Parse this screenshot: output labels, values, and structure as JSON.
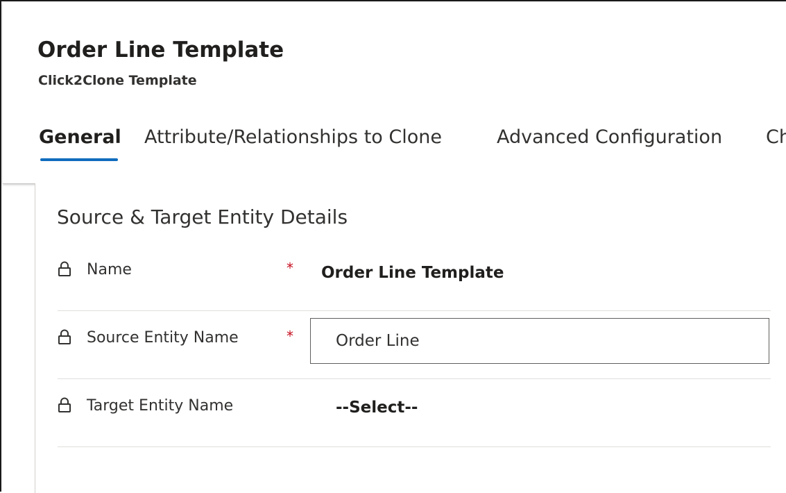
{
  "record": {
    "title": "Order Line Template",
    "subtitle": "Click2Clone Template"
  },
  "tabs": [
    {
      "label": "General",
      "active": true
    },
    {
      "label": "Attribute/Relationships to Clone",
      "active": false
    },
    {
      "label": "Advanced Configuration",
      "active": false
    },
    {
      "label": "Ch",
      "active": false
    }
  ],
  "section": {
    "title": "Source & Target Entity Details",
    "fields": [
      {
        "label": "Name",
        "required": true,
        "required_mark": "*",
        "value": "Order Line Template",
        "locked": true
      },
      {
        "label": "Source Entity Name",
        "required": true,
        "required_mark": "*",
        "value": "Order Line",
        "locked": true
      },
      {
        "label": "Target Entity Name",
        "required": false,
        "value": "--Select--",
        "locked": true
      }
    ]
  },
  "icons": {
    "lock": "lock-icon"
  },
  "colors": {
    "accent": "#0f6cbd",
    "required": "#c50f1f",
    "text": "#323130"
  }
}
